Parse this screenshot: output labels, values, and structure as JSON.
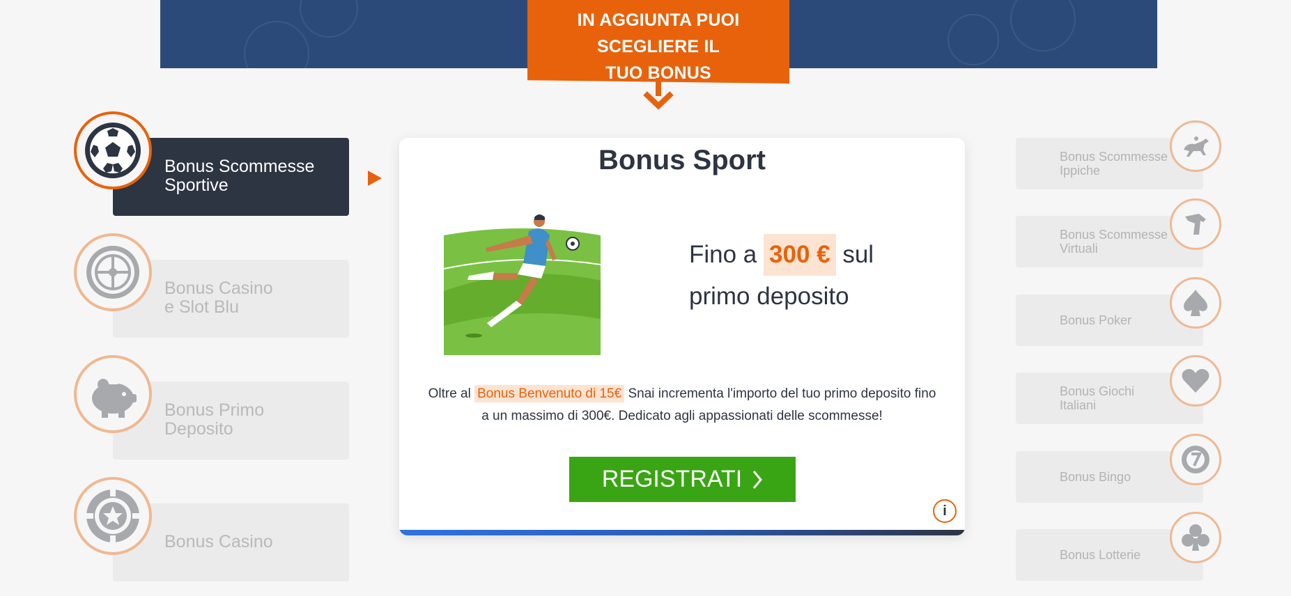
{
  "banner": {
    "promo_line1": "IN AGGIUNTA PUOI SCEGLIERE IL",
    "promo_line2": "TUO BONUS PERSONALIZZATO"
  },
  "left_tabs": [
    {
      "line1": "Bonus Scommesse",
      "line2": "Sportive",
      "icon": "soccer-ball-icon",
      "active": true
    },
    {
      "line1": "Bonus Casino",
      "line2": "e Slot Blu",
      "icon": "roulette-icon",
      "active": false
    },
    {
      "line1": "Bonus Primo",
      "line2": "Deposito",
      "icon": "piggy-bank-icon",
      "active": false
    },
    {
      "line1": "Bonus Casino",
      "line2": "",
      "icon": "poker-chip-icon",
      "active": false
    }
  ],
  "card": {
    "title": "Bonus Sport",
    "offer_prefix": "Fino a",
    "offer_amount": "300 €",
    "offer_suffix": "sul primo deposito",
    "desc_prefix": "Oltre al",
    "desc_highlight": "Bonus Benvenuto di 15€",
    "desc_suffix": "Snai incrementa l'importo del tuo primo deposito fino a un massimo di 300€. Dedicato agli appassionati delle scommesse!",
    "cta_label": "REGISTRATI",
    "info_label": "i"
  },
  "right_tabs": [
    {
      "line1": "Bonus Scommesse",
      "line2": "Ippiche",
      "icon": "horse-racing-icon"
    },
    {
      "line1": "Bonus Scommesse",
      "line2": "Virtuali",
      "icon": "greyhound-icon"
    },
    {
      "line1": "Bonus Poker",
      "line2": "",
      "icon": "spade-icon"
    },
    {
      "line1": "Bonus Giochi",
      "line2": "Italiani",
      "icon": "heart-icon"
    },
    {
      "line1": "Bonus Bingo",
      "line2": "",
      "icon": "bingo-ball-icon"
    },
    {
      "line1": "Bonus Lotterie",
      "line2": "",
      "icon": "club-icon"
    }
  ],
  "colors": {
    "accent": "#e8620c",
    "dark": "#2d3442",
    "cta_green": "#3aa514",
    "banner_blue": "#2c4a79",
    "highlight_bg": "#fde3d1"
  }
}
